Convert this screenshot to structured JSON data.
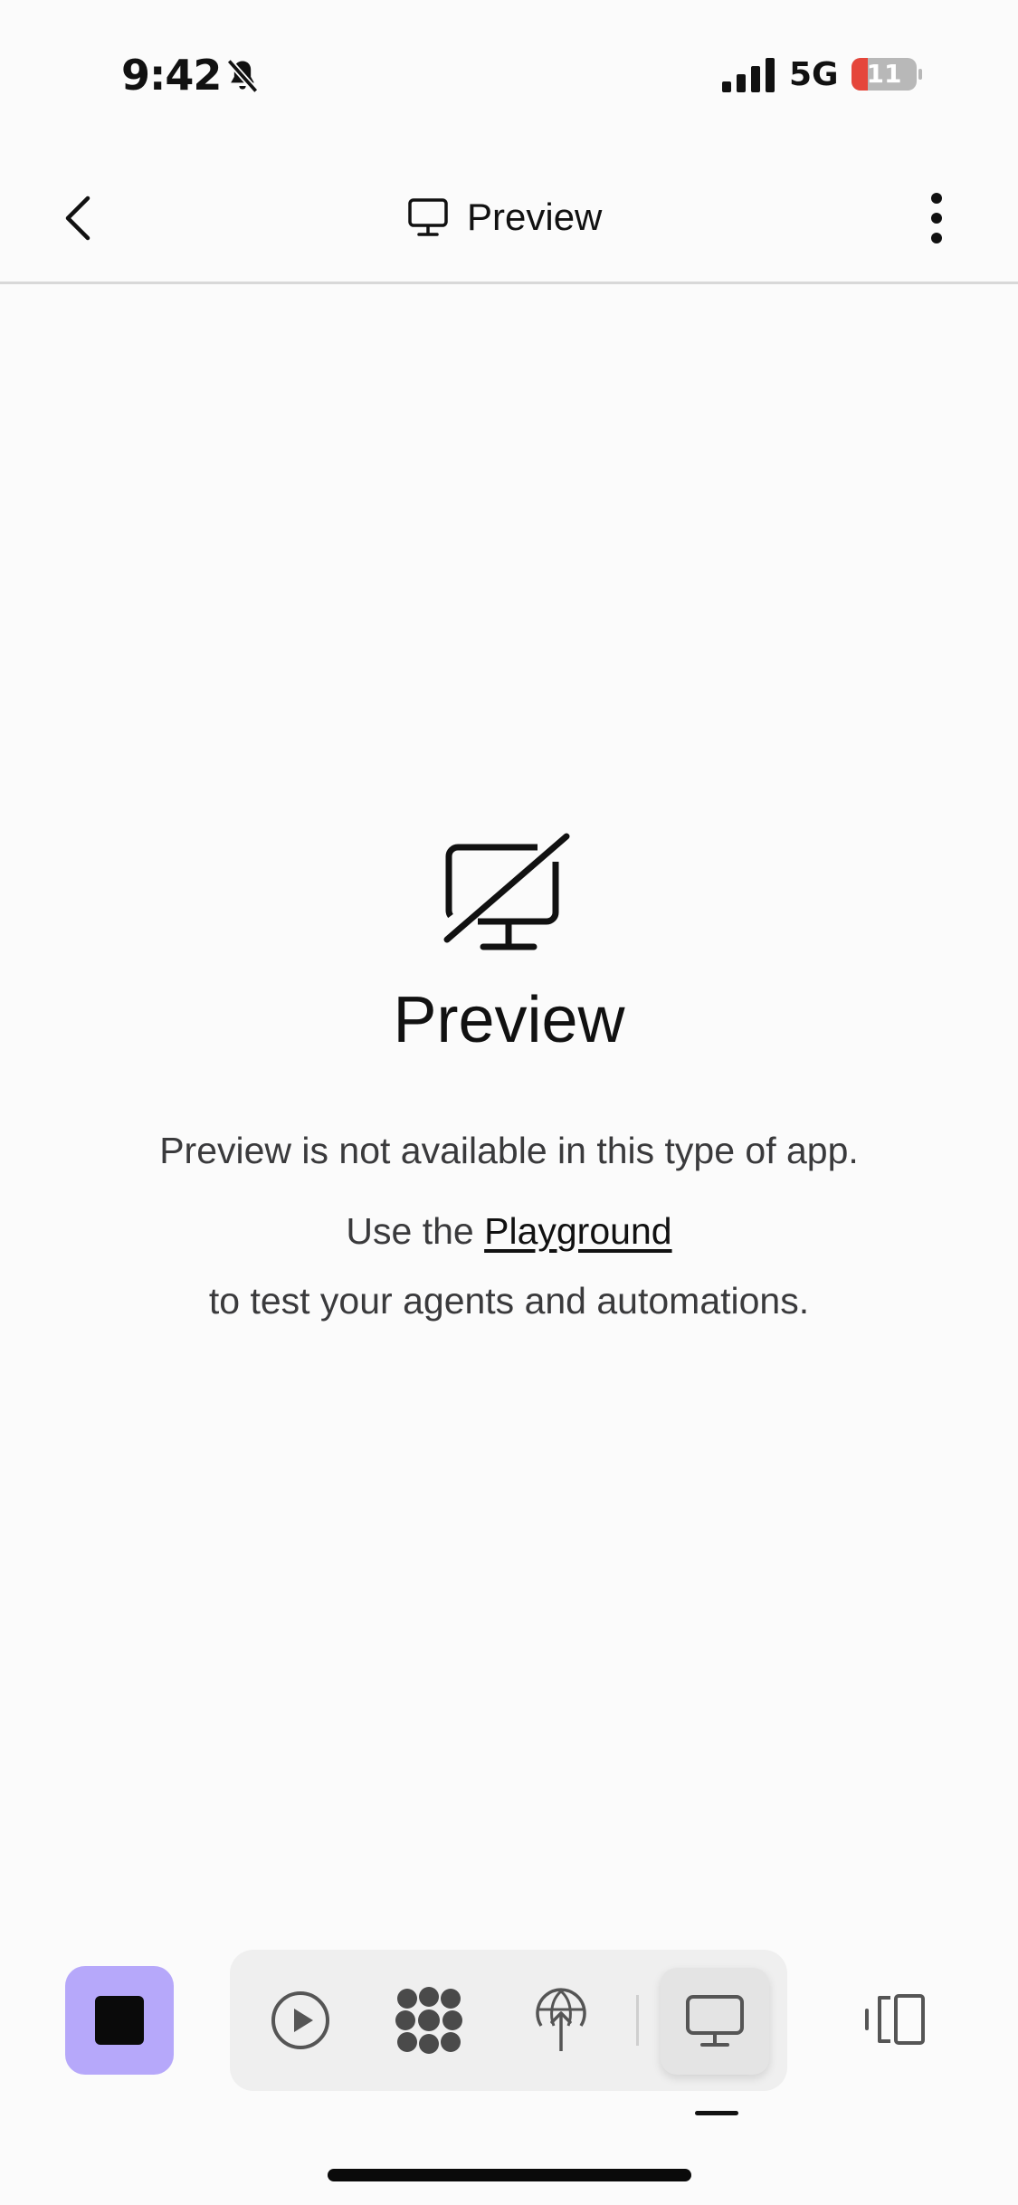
{
  "status_bar": {
    "time": "9:42",
    "network": "5G",
    "battery_level": "11",
    "icons": [
      "bell-off-icon",
      "signal-icon",
      "battery-icon"
    ],
    "battery_color": "#e5463b"
  },
  "nav": {
    "title": "Preview",
    "icons": [
      "chevron-left-icon",
      "monitor-icon",
      "more-vertical-icon"
    ]
  },
  "empty_state": {
    "icon": "monitor-off-icon",
    "title": "Preview",
    "message_line1": "Preview is not available in this type of app.",
    "message_line2_prefix": "Use the ",
    "link_label": "Playground",
    "message_line3": "to test your agents and automations."
  },
  "toolbar": {
    "stop_color": "#b6a8fa",
    "tools": [
      "play-circle-icon",
      "agents-icon",
      "publish-globe-icon",
      "monitor-icon"
    ],
    "side_tool": "split-view-icon",
    "active_tool": "preview"
  }
}
